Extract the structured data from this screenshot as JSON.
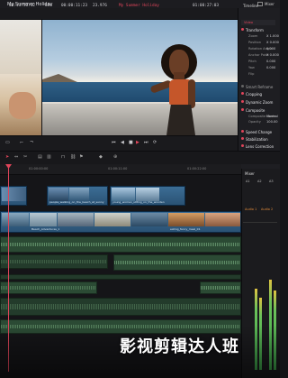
{
  "titlebar": {
    "project_title": "My Summer Holiday",
    "mixer_label": "Mixer"
  },
  "tcbar": {
    "timecode_in": "00:11:58:12",
    "zoom": "63%",
    "timecode_dur": "00:00:11:23",
    "fps": "23.976",
    "timeline_name": "My Summer Holiday",
    "timecode_current": "01:00:27:03",
    "timeline_label": "Timeline - take_next_to_h"
  },
  "inspector": {
    "tab": "Video",
    "sections": {
      "transform": "Transform",
      "smart_reframe": "Smart Reframe",
      "cropping": "Cropping",
      "dynamic_zoom": "Dynamic Zoom",
      "composite": "Composite",
      "speed_change": "Speed Change",
      "stabilization": "Stabilization",
      "lens_correction": "Lens Correction"
    },
    "transform_props": [
      "Zoom",
      "Position",
      "Rotation Angle",
      "Anchor Point",
      "Pitch",
      "Yaw",
      "Flip"
    ],
    "transform_vals": [
      "X 1.000",
      "X 0.000",
      "0.000",
      "X 0.000",
      "0.000",
      "0.000",
      ""
    ],
    "composite_props": [
      "Composite Mode",
      "Opacity"
    ],
    "composite_vals": [
      "Normal",
      "100.00"
    ]
  },
  "ruler": {
    "labels": [
      "01:00:00:00",
      "01:00:11:00",
      "01:00:22:00"
    ]
  },
  "clips": {
    "v1": "Beach_Adventures_1",
    "v2": "people_walking_on_the_beach_at_sunny",
    "v3": "young_woman_sitting_on_the_wooden",
    "v4": "eating_fancy_meal_01"
  },
  "mixer": {
    "title": "Mixer",
    "channels": [
      "A1",
      "A2",
      "A3"
    ],
    "bus_labels": [
      "Audio 1",
      "Audio 2"
    ]
  },
  "brand_text": "影视剪辑达人班"
}
